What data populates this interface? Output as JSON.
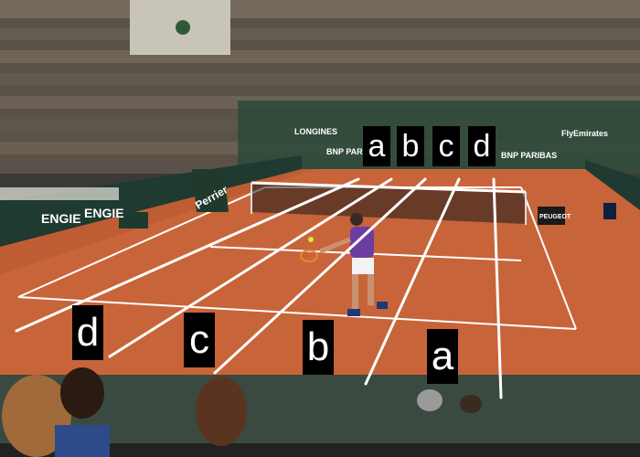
{
  "photo": {
    "subject": "clay-tennis-court",
    "colors": {
      "clay": "#c8643a",
      "clay_dark": "#a9502c",
      "wall": "#2d4a3a",
      "lines": "#ffffff",
      "label_bg": "#000000",
      "label_text": "#ffffff"
    }
  },
  "signage": {
    "sponsor_left": "ENGIE",
    "sponsor_left2": "ENGIE",
    "sponsor_mid": "Perrier",
    "sponsor_top1": "LONGINES",
    "sponsor_top2": "BNP PARIBAS",
    "sponsor_top3": "BNP PARIBAS",
    "sponsor_top4": "FlyEmirates",
    "sponsor_right": "PEUGEOT"
  },
  "labels": {
    "top": [
      "a",
      "b",
      "c",
      "d"
    ],
    "bottom": [
      "d",
      "c",
      "b",
      "a"
    ]
  }
}
